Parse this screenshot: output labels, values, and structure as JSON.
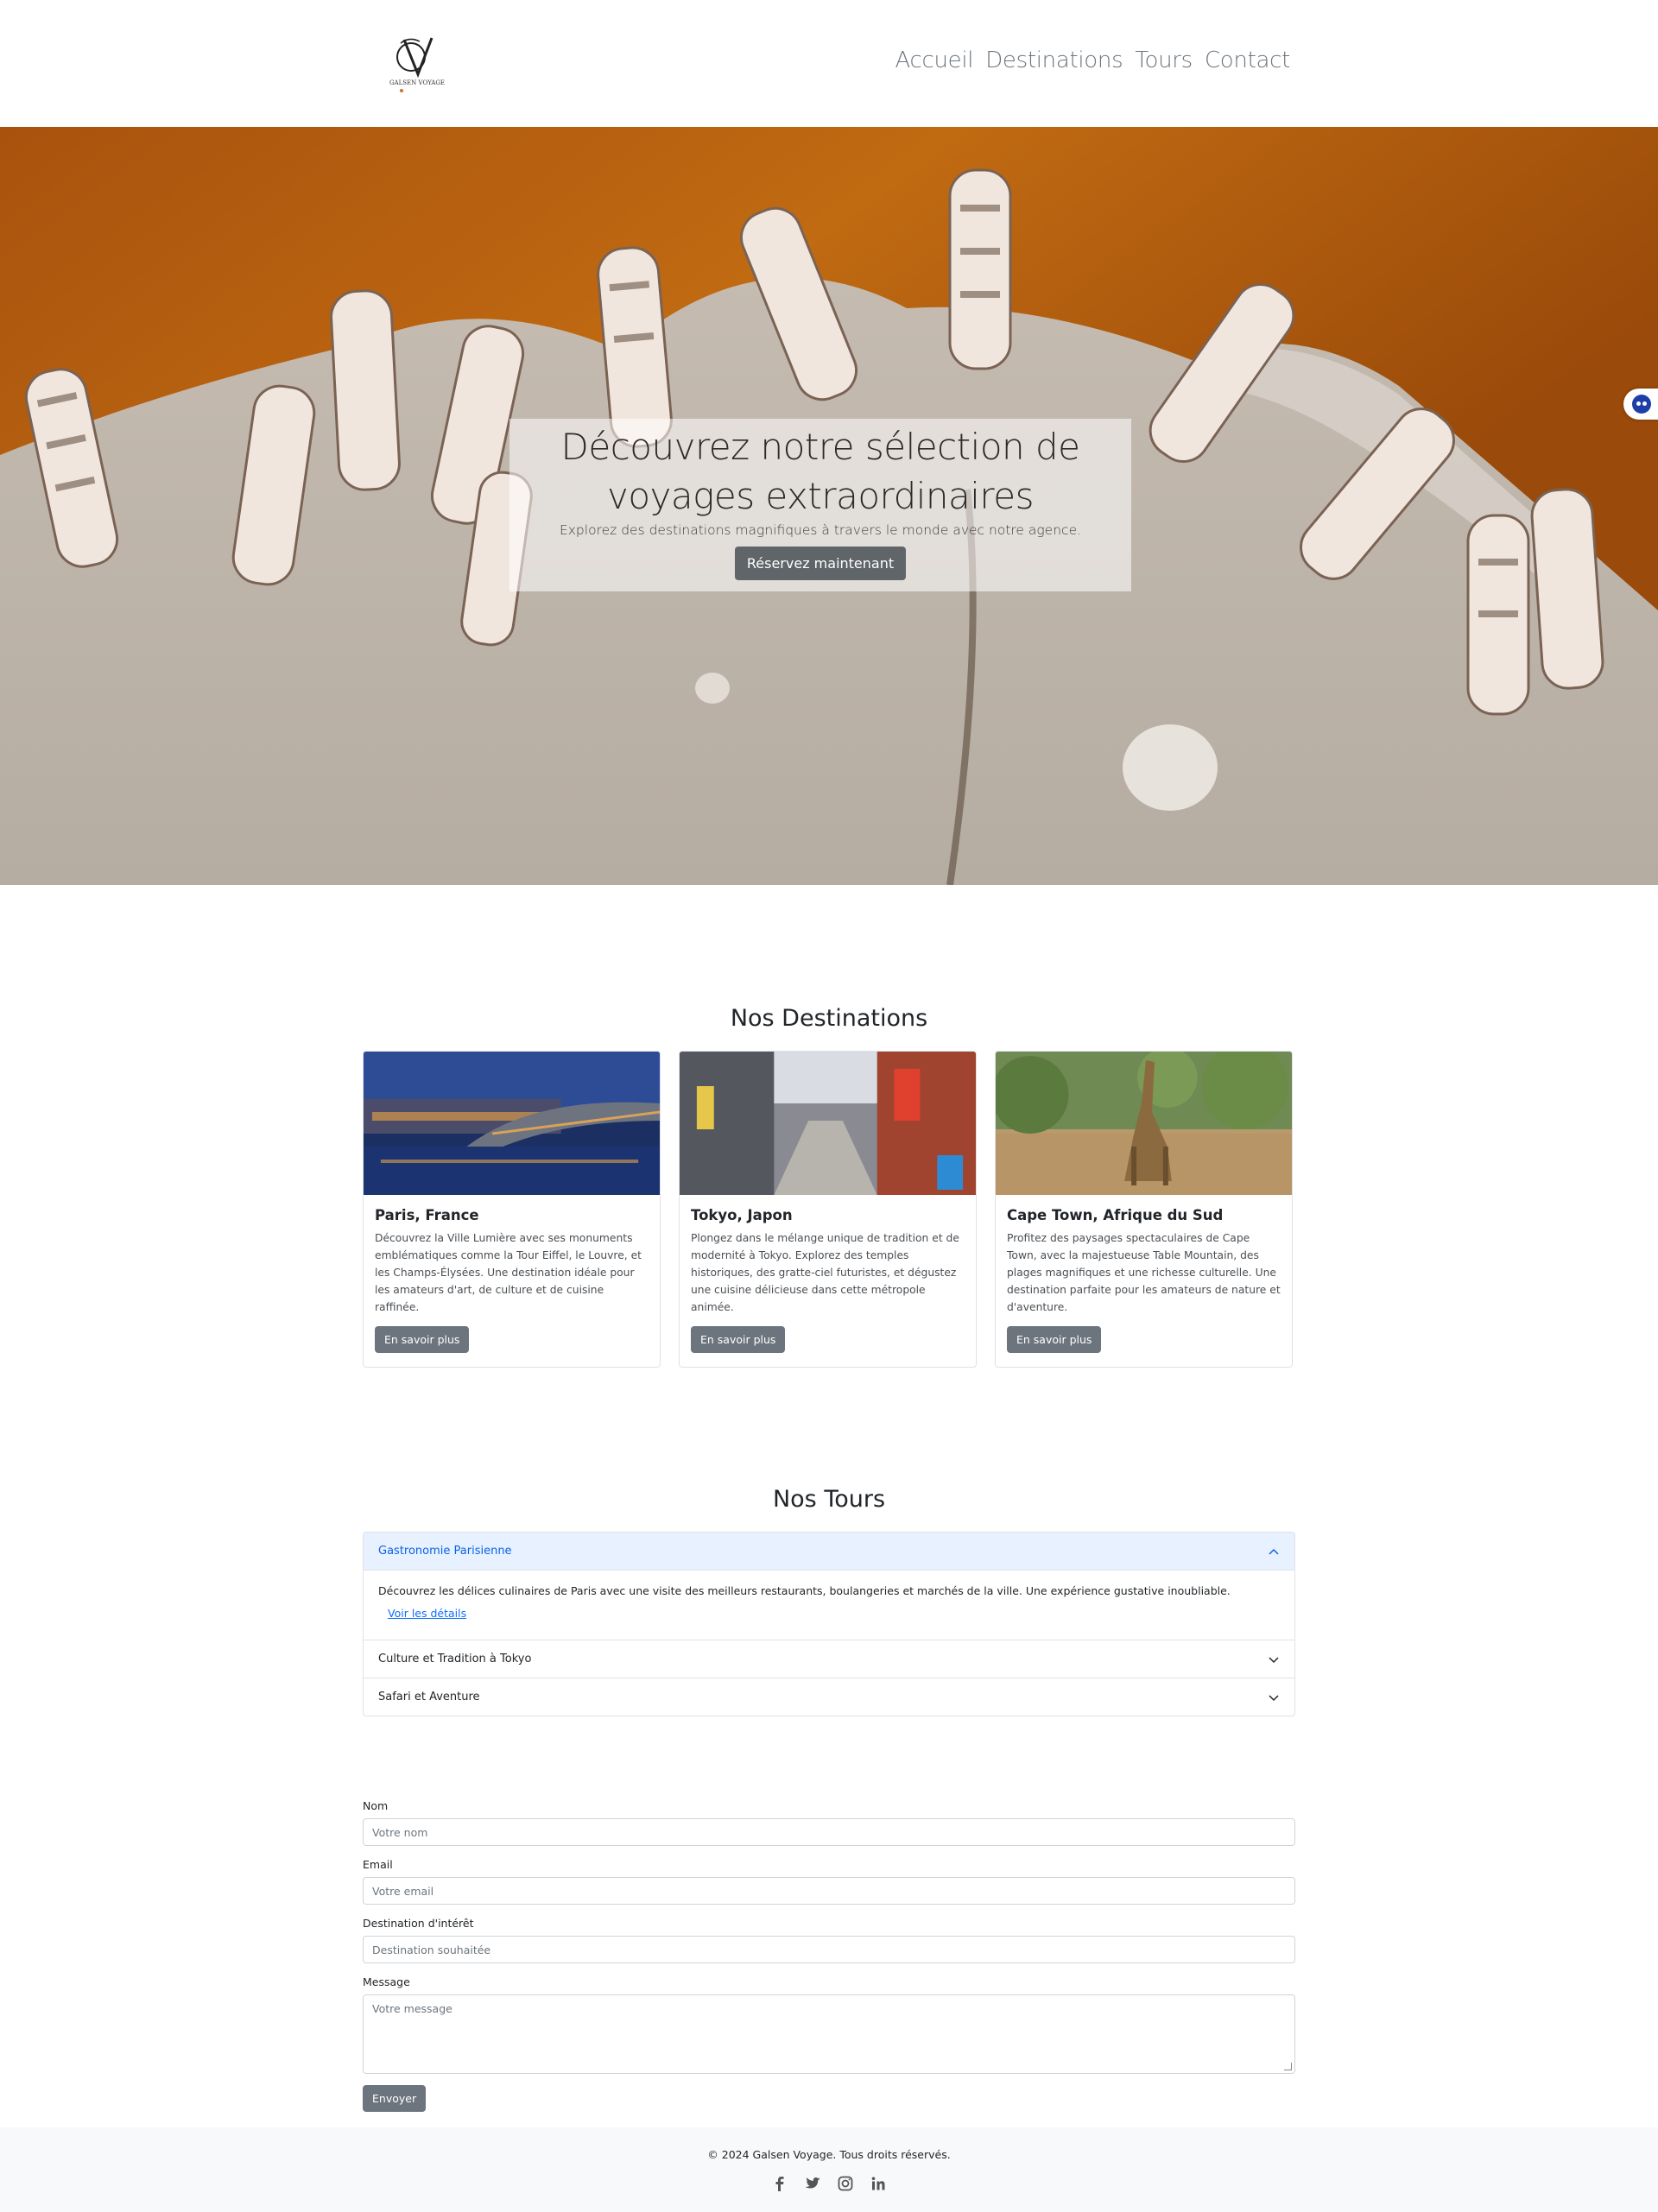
{
  "nav": {
    "logo_text": "GALSEN VOYAGE",
    "links": [
      "Accueil",
      "Destinations",
      "Tours",
      "Contact"
    ]
  },
  "hero": {
    "title": "Découvrez notre sélection de voyages extraordinaires",
    "subtitle": "Explorez des destinations magnifiques à travers le monde avec notre agence.",
    "cta": "Réservez maintenant"
  },
  "destinations": {
    "title": "Nos Destinations",
    "cards": [
      {
        "title": "Paris, France",
        "text": "Découvrez la Ville Lumière avec ses monuments emblématiques comme la Tour Eiffel, le Louvre, et les Champs-Élysées. Une destination idéale pour les amateurs d'art, de culture et de cuisine raffinée.",
        "button": "En savoir plus"
      },
      {
        "title": "Tokyo, Japon",
        "text": "Plongez dans le mélange unique de tradition et de modernité à Tokyo. Explorez des temples historiques, des gratte-ciel futuristes, et dégustez une cuisine délicieuse dans cette métropole animée.",
        "button": "En savoir plus"
      },
      {
        "title": "Cape Town, Afrique du Sud",
        "text": "Profitez des paysages spectaculaires de Cape Town, avec la majestueuse Table Mountain, des plages magnifiques et une richesse culturelle. Une destination parfaite pour les amateurs de nature et d'aventure.",
        "button": "En savoir plus"
      }
    ]
  },
  "tours": {
    "title": "Nos Tours",
    "items": [
      {
        "title": "Gastronomie Parisienne",
        "expanded": true,
        "body": "Découvrez les délices culinaires de Paris avec une visite des meilleurs restaurants, boulangeries et marchés de la ville. Une expérience gustative inoubliable.",
        "link": "Voir les détails"
      },
      {
        "title": "Culture et Tradition à Tokyo",
        "expanded": false
      },
      {
        "title": "Safari et Aventure",
        "expanded": false
      }
    ]
  },
  "form": {
    "name_label": "Nom",
    "name_placeholder": "Votre nom",
    "email_label": "Email",
    "email_placeholder": "Votre email",
    "destination_label": "Destination d'intérêt",
    "destination_placeholder": "Destination souhaitée",
    "message_label": "Message",
    "message_placeholder": "Votre message",
    "submit": "Envoyer"
  },
  "footer": {
    "copyright": "© 2024 Galsen Voyage. Tous droits réservés.",
    "social_icons": [
      "facebook-icon",
      "twitter-icon",
      "instagram-icon",
      "linkedin-icon"
    ]
  },
  "colors": {
    "hero_water": "#b85f10",
    "button_gray": "#6c757d",
    "accordion_active_bg": "#e7f1ff",
    "accordion_active_text": "#0c63e4",
    "link_blue": "#0d6efd"
  }
}
